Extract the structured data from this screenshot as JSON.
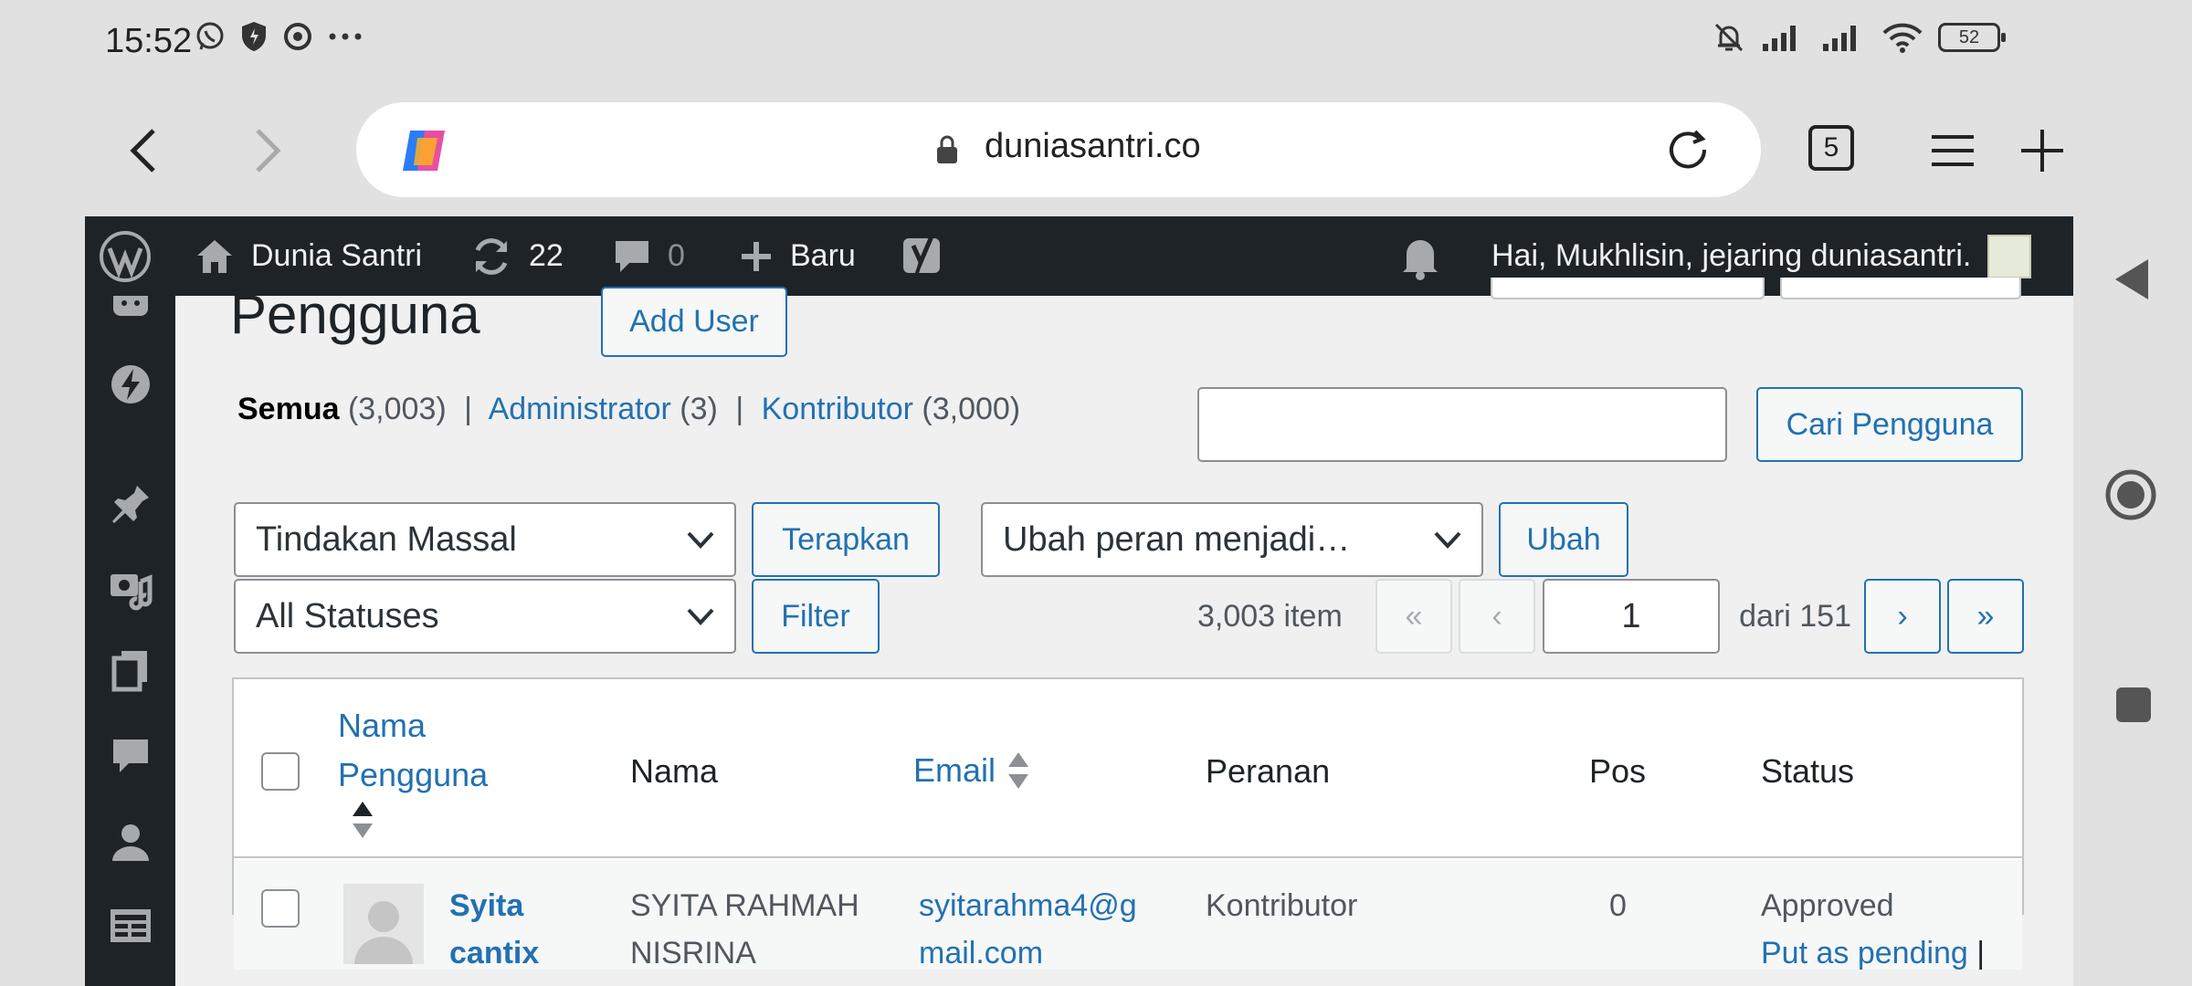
{
  "status_bar": {
    "time": "15:52",
    "battery": "52"
  },
  "browser": {
    "url": "duniasantri.co",
    "tab_count": "5"
  },
  "admin_bar": {
    "site_name": "Dunia Santri",
    "updates": "22",
    "comments": "0",
    "new_label": "Baru",
    "greeting": "Hai, Mukhlisin, jejaring duniasantri."
  },
  "page": {
    "title": "Pengguna",
    "add_user": "Add User"
  },
  "filters": {
    "all_label": "Semua",
    "all_count": "(3,003)",
    "admin_label": "Administrator",
    "admin_count": "(3)",
    "contrib_label": "Kontributor",
    "contrib_count": "(3,000)"
  },
  "search": {
    "value": "",
    "button": "Cari Pengguna"
  },
  "bulk": {
    "action_selected": "Tindakan Massal",
    "apply": "Terapkan",
    "role_selected": "Ubah peran menjadi…",
    "change": "Ubah",
    "status_selected": "All Statuses",
    "filter": "Filter"
  },
  "pagination": {
    "items": "3,003 item",
    "first": "«",
    "prev": "‹",
    "current": "1",
    "of_total": "dari 151",
    "next": "›",
    "last": "»"
  },
  "table": {
    "headers": {
      "username": "Nama Pengguna",
      "name": "Nama",
      "email": "Email",
      "role": "Peranan",
      "posts": "Pos",
      "status": "Status"
    },
    "rows": [
      {
        "username_line1": "Syita",
        "username_line2": "cantix",
        "name_line1": "SYITA RAHMAH",
        "name_line2": "NISRINA",
        "email_line1": "syitarahma4@g",
        "email_line2": "mail.com",
        "role": "Kontributor",
        "posts": "0",
        "status": "Approved",
        "status_action": "Put as pending",
        "status_sep": "|"
      }
    ]
  }
}
